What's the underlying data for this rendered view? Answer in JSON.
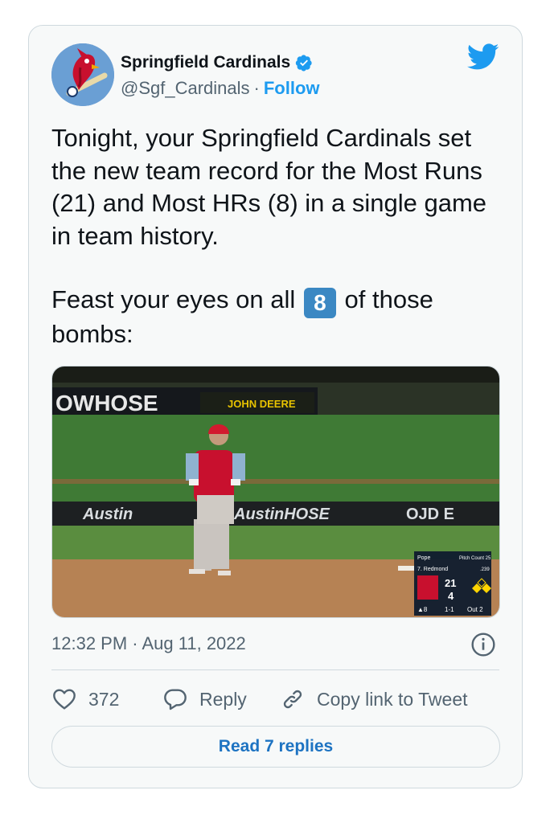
{
  "author": {
    "name": "Springfield Cardinals",
    "handle": "@Sgf_Cardinals",
    "separator": "·",
    "follow_label": "Follow"
  },
  "tweet": {
    "paragraph1": "Tonight, your Springfield Cardinals set the new team record for the Most Runs (21) and Most HRs (8) in a single game in team history.",
    "paragraph2_before": "Feast your eyes on all ",
    "keycap": "8",
    "paragraph2_after": " of those bombs:"
  },
  "media": {
    "signs": {
      "top_left": "OWHOSE",
      "sponsor_top": "JOHN DEERE",
      "wall1": "Austin",
      "wall2": "AustinHOSE",
      "wall3": "OJD E"
    },
    "scorebug": {
      "pitcher": "Pope",
      "pitch_count_label": "Pitch Count 25",
      "batter": "7. Redmond",
      "batter_avg": ".239",
      "home_score": "21",
      "away_score": "4",
      "inning": "▲8",
      "count": "1-1",
      "outs": "Out 2"
    }
  },
  "meta": {
    "timestamp": "12:32 PM · Aug 11, 2022"
  },
  "actions": {
    "likes": "372",
    "reply_label": "Reply",
    "copy_label": "Copy link to Tweet"
  },
  "footer": {
    "read_replies": "Read 7 replies"
  },
  "colors": {
    "accent": "#1d9bf0",
    "keycap": "#3b88c3",
    "text": "#0f1419",
    "muted": "#536471"
  }
}
